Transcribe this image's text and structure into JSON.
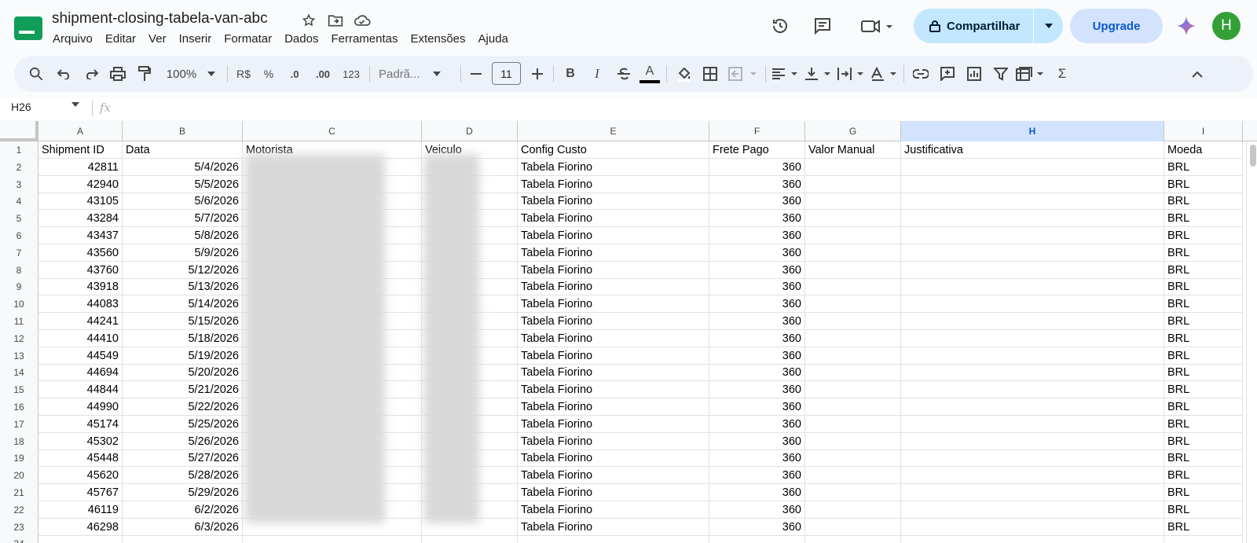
{
  "app": {
    "title": "shipment-closing-tabela-van-abc",
    "menu": [
      "Arquivo",
      "Editar",
      "Ver",
      "Inserir",
      "Formatar",
      "Dados",
      "Ferramentas",
      "Extensões",
      "Ajuda"
    ],
    "share_label": "Compartilhar",
    "upgrade_label": "Upgrade",
    "avatar_initial": "H",
    "colors": {
      "share_bg": "#c2e7ff",
      "upgrade_bg": "#d3e3fd",
      "avatar_bg": "#33a036",
      "selected_col": "#d3e3fd"
    }
  },
  "toolbar": {
    "zoom": "100%",
    "currency": "R$",
    "percent": "%",
    "dec_decrease": ".0",
    "dec_increase": ".00",
    "more_formats": "123",
    "font": "Padrã...",
    "font_size": "11",
    "bold": "B",
    "italic": "I",
    "text_color": "A",
    "sum": "Σ"
  },
  "formula_bar": {
    "name_box": "H26",
    "fx": "fx"
  },
  "sheet": {
    "columns": [
      "A",
      "B",
      "C",
      "D",
      "E",
      "F",
      "G",
      "H",
      "I"
    ],
    "selected_column": "H",
    "header": [
      "Shipment ID",
      "Data",
      "Motorista",
      "Veiculo",
      "Config Custo",
      "Frete Pago",
      "Valor Manual",
      "Justificativa",
      "Moeda"
    ],
    "rows": [
      [
        "42811",
        "5/4/2026",
        "",
        "",
        "Tabela Fiorino",
        "360",
        "",
        "",
        "BRL"
      ],
      [
        "42940",
        "5/5/2026",
        "",
        "",
        "Tabela Fiorino",
        "360",
        "",
        "",
        "BRL"
      ],
      [
        "43105",
        "5/6/2026",
        "",
        "",
        "Tabela Fiorino",
        "360",
        "",
        "",
        "BRL"
      ],
      [
        "43284",
        "5/7/2026",
        "",
        "",
        "Tabela Fiorino",
        "360",
        "",
        "",
        "BRL"
      ],
      [
        "43437",
        "5/8/2026",
        "",
        "",
        "Tabela Fiorino",
        "360",
        "",
        "",
        "BRL"
      ],
      [
        "43560",
        "5/9/2026",
        "",
        "",
        "Tabela Fiorino",
        "360",
        "",
        "",
        "BRL"
      ],
      [
        "43760",
        "5/12/2026",
        "",
        "",
        "Tabela Fiorino",
        "360",
        "",
        "",
        "BRL"
      ],
      [
        "43918",
        "5/13/2026",
        "",
        "",
        "Tabela Fiorino",
        "360",
        "",
        "",
        "BRL"
      ],
      [
        "44083",
        "5/14/2026",
        "",
        "",
        "Tabela Fiorino",
        "360",
        "",
        "",
        "BRL"
      ],
      [
        "44241",
        "5/15/2026",
        "",
        "",
        "Tabela Fiorino",
        "360",
        "",
        "",
        "BRL"
      ],
      [
        "44410",
        "5/18/2026",
        "",
        "",
        "Tabela Fiorino",
        "360",
        "",
        "",
        "BRL"
      ],
      [
        "44549",
        "5/19/2026",
        "",
        "",
        "Tabela Fiorino",
        "360",
        "",
        "",
        "BRL"
      ],
      [
        "44694",
        "5/20/2026",
        "",
        "",
        "Tabela Fiorino",
        "360",
        "",
        "",
        "BRL"
      ],
      [
        "44844",
        "5/21/2026",
        "",
        "",
        "Tabela Fiorino",
        "360",
        "",
        "",
        "BRL"
      ],
      [
        "44990",
        "5/22/2026",
        "",
        "",
        "Tabela Fiorino",
        "360",
        "",
        "",
        "BRL"
      ],
      [
        "45174",
        "5/25/2026",
        "",
        "",
        "Tabela Fiorino",
        "360",
        "",
        "",
        "BRL"
      ],
      [
        "45302",
        "5/26/2026",
        "",
        "",
        "Tabela Fiorino",
        "360",
        "",
        "",
        "BRL"
      ],
      [
        "45448",
        "5/27/2026",
        "",
        "",
        "Tabela Fiorino",
        "360",
        "",
        "",
        "BRL"
      ],
      [
        "45620",
        "5/28/2026",
        "",
        "",
        "Tabela Fiorino",
        "360",
        "",
        "",
        "BRL"
      ],
      [
        "45767",
        "5/29/2026",
        "",
        "",
        "Tabela Fiorino",
        "360",
        "",
        "",
        "BRL"
      ],
      [
        "46119",
        "6/2/2026",
        "",
        "",
        "Tabela Fiorino",
        "360",
        "",
        "",
        "BRL"
      ],
      [
        "46298",
        "6/3/2026",
        "",
        "",
        "Tabela Fiorino",
        "360",
        "",
        "",
        "BRL"
      ]
    ],
    "row_numbers": [
      "1",
      "2",
      "3",
      "4",
      "5",
      "6",
      "7",
      "8",
      "9",
      "10",
      "11",
      "12",
      "13",
      "14",
      "15",
      "16",
      "17",
      "18",
      "19",
      "20",
      "21",
      "22",
      "23",
      "24"
    ]
  }
}
